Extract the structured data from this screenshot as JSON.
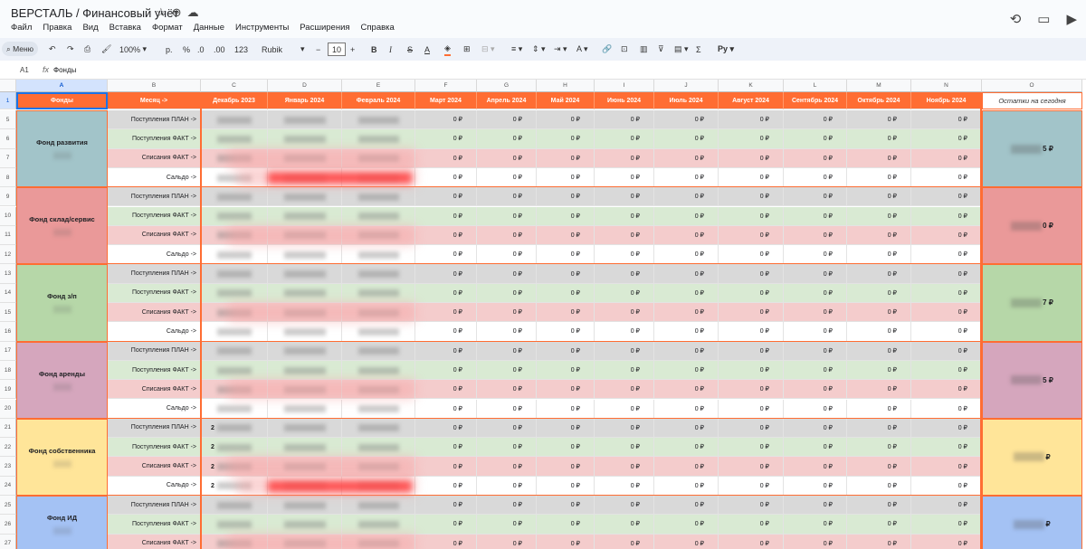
{
  "app": {
    "doc_title": "ВЕРСТАЛЬ / Финансовый учёт",
    "menu": [
      "Файл",
      "Правка",
      "Вид",
      "Вставка",
      "Формат",
      "Данные",
      "Инструменты",
      "Расширения",
      "Справка"
    ]
  },
  "toolbar": {
    "search": "Меню",
    "zoom": "100%",
    "currency": "р.",
    "percent": "%",
    "dec_less": ".0",
    "dec_more": ".00",
    "fmt_123": "123",
    "font": "Rubik",
    "font_size": "10",
    "bold": "B",
    "italic": "I",
    "strike": "S",
    "textcolor": "A",
    "sum": "Σ"
  },
  "formula": {
    "cell_ref": "A1",
    "fx": "fx",
    "value": "Фонды"
  },
  "columns": [
    "A",
    "B",
    "C",
    "D",
    "E",
    "F",
    "G",
    "H",
    "I",
    "J",
    "K",
    "L",
    "M",
    "N",
    "O"
  ],
  "header_row": {
    "num": "1",
    "cells": [
      "Фонды",
      "Месяц ->",
      "Декабрь 2023",
      "Январь 2024",
      "Февраль 2024",
      "Март 2024",
      "Апрель 2024",
      "Май 2024",
      "Июнь 2024",
      "Июль 2024",
      "Август 2024",
      "Сентябрь 2024",
      "Октябрь 2024",
      "Ноябрь 2024",
      "Остатки на сегодня"
    ]
  },
  "row_labels": [
    "Поступления ПЛАН ->",
    "Поступления ФАКТ ->",
    "Списания ФАКТ ->",
    "Сальдо ->"
  ],
  "zero": "0 ₽",
  "funds": [
    {
      "name": "Фонд развития",
      "rows": [
        "5",
        "6",
        "7",
        "8"
      ],
      "balance_suffix": "5 ₽",
      "color": "#a2c4c9"
    },
    {
      "name": "Фонд склад/сервис",
      "rows": [
        "9",
        "10",
        "11",
        "12"
      ],
      "balance_suffix": "0 ₽",
      "color": "#ea9999"
    },
    {
      "name": "Фонд з/п",
      "rows": [
        "13",
        "14",
        "15",
        "16"
      ],
      "balance_suffix": "7 ₽",
      "color": "#b6d7a8"
    },
    {
      "name": "Фонд аренды",
      "rows": [
        "17",
        "18",
        "19",
        "20"
      ],
      "balance_suffix": "5 ₽",
      "color": "#d5a6bd"
    },
    {
      "name": "Фонд собственника",
      "rows": [
        "21",
        "22",
        "23",
        "24"
      ],
      "balance_suffix": "₽",
      "color": "#ffe599"
    },
    {
      "name": "Фонд ИД",
      "rows": [
        "25",
        "26",
        "27"
      ],
      "balance_suffix": "₽",
      "color": "#a4c2f4"
    }
  ],
  "owner_fund_c_prefix": "2"
}
